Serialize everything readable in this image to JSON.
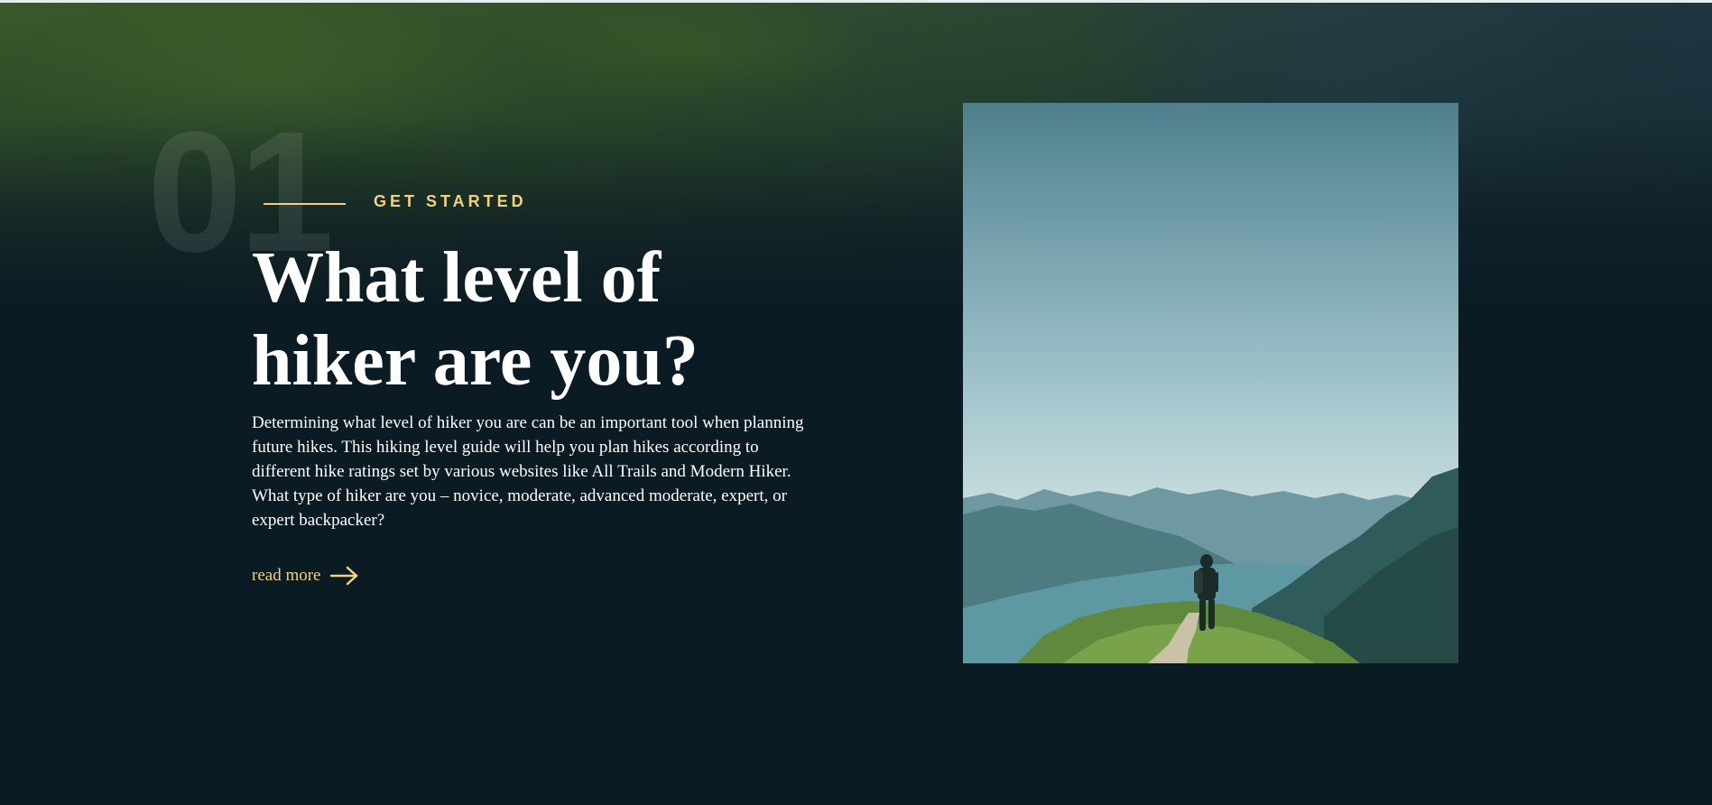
{
  "section": {
    "number": "01",
    "eyebrow": "GET STARTED",
    "heading": "What level of hiker are you?",
    "description": "Determining what level of hiker you are can be an important tool when planning future hikes. This hiking level guide will help you plan hikes according to different hike ratings set by various websites like All Trails and Modern Hiker. What type of hiker are you – novice, moderate, advanced moderate, expert, or expert backpacker?",
    "read_more_label": "read more",
    "read_more_icon": "arrow-right-icon"
  },
  "images": {
    "background": "mountain-hillside-photo",
    "feature": "hiker-on-mountain-ridge-photo"
  },
  "colors": {
    "background": "#0b1b24",
    "accent": "#f2d27d",
    "text": "#ffffff"
  }
}
